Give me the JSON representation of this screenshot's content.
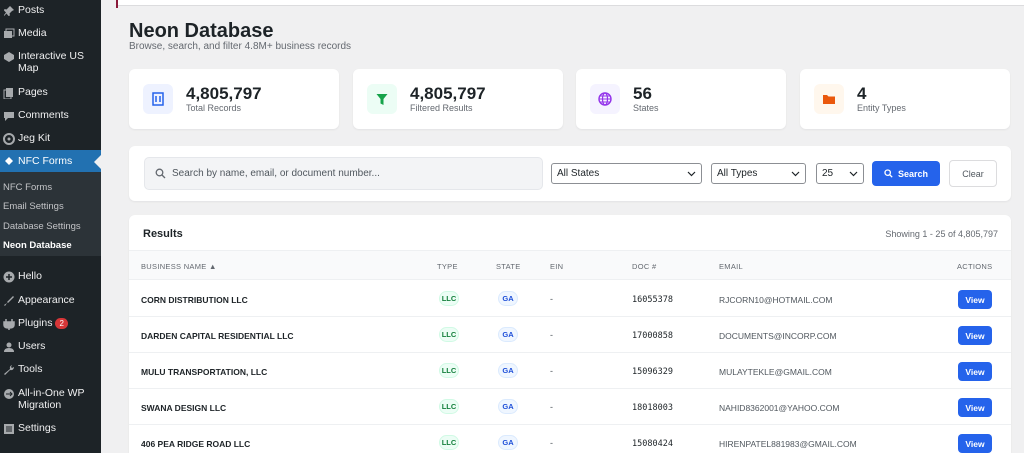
{
  "sidebar": {
    "items": [
      {
        "label": "Posts",
        "icon": "pin-icon"
      },
      {
        "label": "Media",
        "icon": "media-icon"
      },
      {
        "label": "Interactive US Map",
        "icon": "map-icon"
      },
      {
        "label": "Pages",
        "icon": "pages-icon"
      },
      {
        "label": "Comments",
        "icon": "comments-icon"
      },
      {
        "label": "Jeg Kit",
        "icon": "jegkit-icon"
      },
      {
        "label": "NFC Forms",
        "icon": "nfc-icon"
      },
      {
        "label": "Hello",
        "icon": "plus-icon"
      },
      {
        "label": "Appearance",
        "icon": "appearance-icon"
      },
      {
        "label": "Plugins",
        "icon": "plugins-icon",
        "badge": "2"
      },
      {
        "label": "Users",
        "icon": "users-icon"
      },
      {
        "label": "Tools",
        "icon": "tools-icon"
      },
      {
        "label": "All-in-One WP Migration",
        "icon": "migration-icon"
      },
      {
        "label": "Settings",
        "icon": "settings-icon"
      }
    ],
    "submenu": [
      "NFC Forms",
      "Email Settings",
      "Database Settings",
      "Neon Database"
    ]
  },
  "page": {
    "title": "Neon Database",
    "subtitle": "Browse, search, and filter 4.8M+ business records"
  },
  "stats": [
    {
      "value": "4,805,797",
      "label": "Total Records",
      "color": "#2563eb",
      "bg": "#eef2ff"
    },
    {
      "value": "4,805,797",
      "label": "Filtered Results",
      "color": "#16a34a",
      "bg": "#ecfdf5"
    },
    {
      "value": "56",
      "label": "States",
      "color": "#9333ea",
      "bg": "#f5f3ff"
    },
    {
      "value": "4",
      "label": "Entity Types",
      "color": "#ea580c",
      "bg": "#fff7ed"
    }
  ],
  "filters": {
    "search_placeholder": "Search by name, email, or document number...",
    "state": "All States",
    "type": "All Types",
    "per_page": "25",
    "search_label": "Search",
    "clear_label": "Clear"
  },
  "results": {
    "title": "Results",
    "showing": "Showing 1 - 25 of 4,805,797",
    "columns": [
      "BUSINESS NAME ▲",
      "TYPE",
      "STATE",
      "EIN",
      "DOC #",
      "EMAIL",
      "ACTIONS"
    ],
    "rows": [
      {
        "name": "CORN DISTRIBUTION LLC",
        "type": "LLC",
        "state": "GA",
        "ein": "-",
        "doc": "16055378",
        "email": "RJCORN10@HOTMAIL.COM",
        "action": "View"
      },
      {
        "name": "DARDEN CAPITAL RESIDENTIAL LLC",
        "type": "LLC",
        "state": "GA",
        "ein": "-",
        "doc": "17000858",
        "email": "DOCUMENTS@INCORP.COM",
        "action": "View"
      },
      {
        "name": "MULU TRANSPORTATION, LLC",
        "type": "LLC",
        "state": "GA",
        "ein": "-",
        "doc": "15096329",
        "email": "MULAYTEKLE@GMAIL.COM",
        "action": "View"
      },
      {
        "name": "SWANA DESIGN LLC",
        "type": "LLC",
        "state": "GA",
        "ein": "-",
        "doc": "18018003",
        "email": "NAHID8362001@YAHOO.COM",
        "action": "View"
      },
      {
        "name": "406 PEA RIDGE ROAD LLC",
        "type": "LLC",
        "state": "GA",
        "ein": "-",
        "doc": "15080424",
        "email": "HIRENPATEL881983@GMAIL.COM",
        "action": "View"
      }
    ]
  }
}
